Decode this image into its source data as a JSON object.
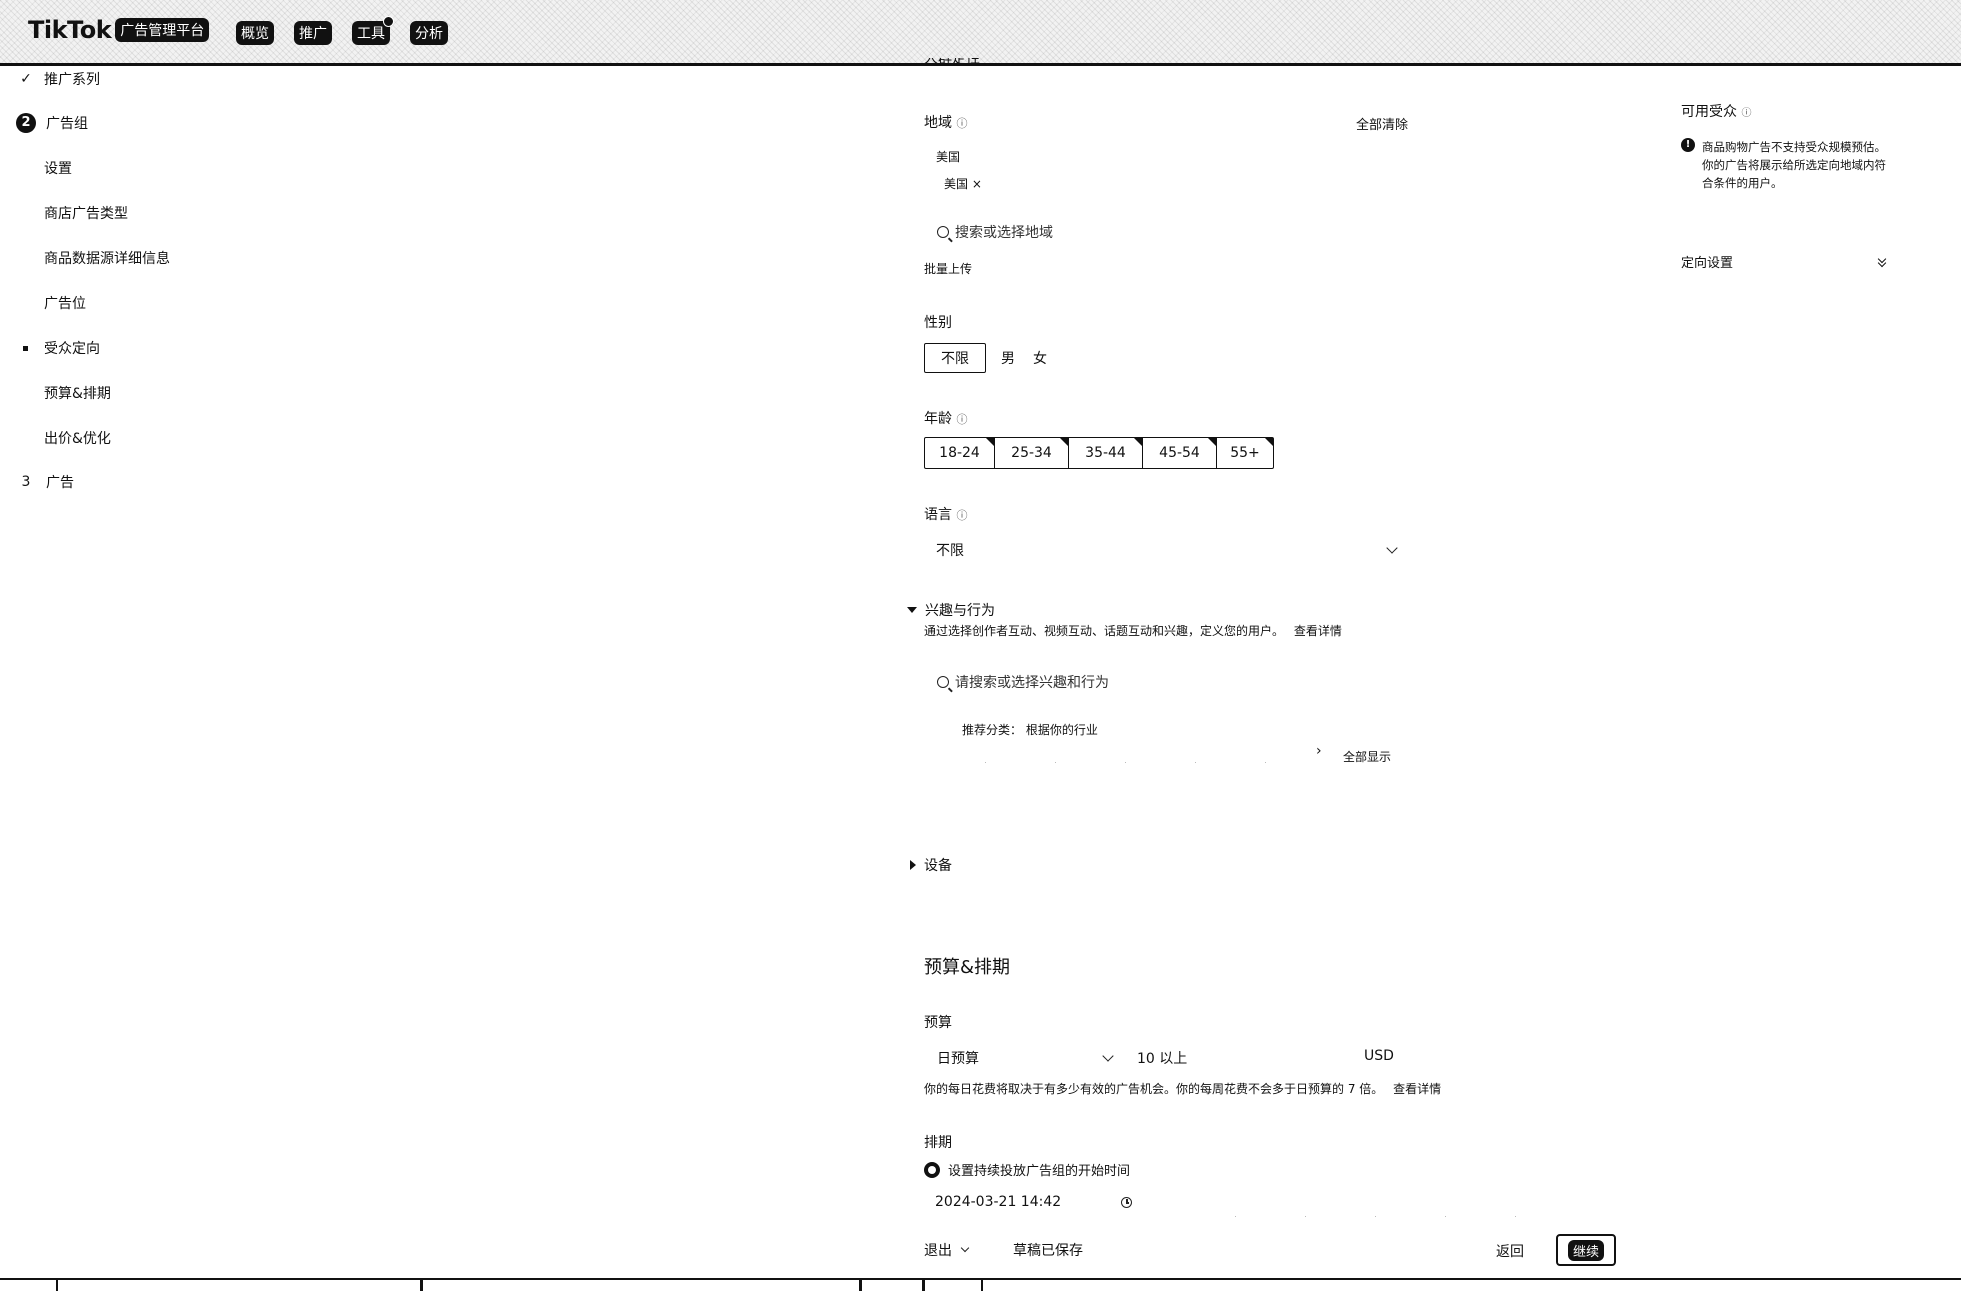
{
  "header": {
    "brand": "TikTok",
    "brand_sub": "广告管理平台",
    "nav": [
      {
        "label": "概览"
      },
      {
        "label": "推广"
      },
      {
        "label": "工具"
      },
      {
        "label": "分析"
      }
    ]
  },
  "sidebar": {
    "steps": [
      {
        "marker": "✓",
        "label": "推广系列"
      },
      {
        "marker": "2",
        "label": "广告组"
      },
      {
        "label": "设置"
      },
      {
        "label": "商店广告类型"
      },
      {
        "label": "商品数据源详细信息"
      },
      {
        "label": "广告位"
      },
      {
        "label": "受众定向"
      },
      {
        "label": "预算&排期"
      },
      {
        "label": "出价&优化"
      },
      {
        "marker": "3",
        "label": "广告"
      }
    ]
  },
  "targeting": {
    "cut_header": "人群定性",
    "location_label": "地域",
    "clear_all": "全部清除",
    "location_group": "美国",
    "location_tag": "美国",
    "location_search_placeholder": "搜索或选择地域",
    "bulk_upload": "批量上传",
    "gender_label": "性别",
    "gender_options": [
      "不限",
      "男",
      "女"
    ],
    "age_label": "年龄",
    "age_options": [
      "18-24",
      "25-34",
      "35-44",
      "45-54",
      "55+"
    ],
    "language_label": "语言",
    "language_value": "不限",
    "interests_title": "兴趣与行为",
    "interests_desc": "通过选择创作者互动、视频互动、话题互动和兴趣，定义您的用户。",
    "interests_link": "查看详情",
    "interests_search_placeholder": "请搜索或选择兴趣和行为",
    "recommended_label": "推荐分类：",
    "recommended_value": "根据你的行业",
    "show_all": "全部显示",
    "device_title": "设备"
  },
  "budget": {
    "section_title": "预算&排期",
    "budget_label": "预算",
    "budget_type": "日预算",
    "budget_amount": "10 以上",
    "currency": "USD",
    "budget_note": "你的每日花费将取决于有多少有效的广告机会。你的每周花费不会多于日预算的 7 倍。",
    "budget_note_link": "查看详情",
    "schedule_label": "排期",
    "schedule_option": "设置持续投放广告组的开始时间",
    "start_time": "2024-03-21 14:42"
  },
  "footer": {
    "exit": "退出",
    "draft_saved": "草稿已保存",
    "back": "返回",
    "continue": "继续"
  },
  "right_panel": {
    "available_audience": "可用受众",
    "info_text": "商品购物广告不支持受众规模预估。你的广告将展示给所选定向地域内符合条件的用户。",
    "targeting_settings": "定向设置"
  }
}
